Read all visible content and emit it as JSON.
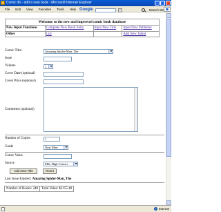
{
  "window": {
    "title": "Comic db - add a new book - Microsoft Internet Explorer"
  },
  "menu": {
    "items": [
      "File",
      "Edit",
      "View",
      "Favorites",
      "Tools",
      "Help"
    ]
  },
  "google_toolbar": {
    "logo": "Google",
    "search_label": "Search Web"
  },
  "header": {
    "welcome": "Welcome to the new and improved comic book database",
    "row1_label": "New Input Functions",
    "row1_links": [
      "Complete New Book Entry",
      "Input New Title",
      "Input New Publisher"
    ],
    "row2_label": "Other",
    "row2_links": [
      "List",
      "",
      "Add New Talent"
    ]
  },
  "form": {
    "comic_title_label": "Comic Title:",
    "comic_title_value": "Amazing Spider-Man, The",
    "issue_label": "Issue",
    "volume_label": "Volume",
    "volume_value": "1",
    "cover_date_label": "Cover Date (optional)",
    "cover_price_label": "Cover Price (optional)",
    "comments_label": "Comments (optional)",
    "num_copies_label": "Number of Copies",
    "num_copies_value": "1",
    "grade_label": "Grade",
    "grade_value": "Near Mint",
    "comic_value_label": "Comic Value",
    "source_label": "Source",
    "source_value": "Mile High Comics",
    "add_button": "Add New Title",
    "reset_button": "Reset"
  },
  "last_issue": {
    "label": "Last Issue Entered:",
    "value": "Amazing Spider-Man, The"
  },
  "totals": {
    "books": "Number of Books: 240",
    "value": "Total Value: $2155.40"
  },
  "status": {
    "zone": "Internet"
  }
}
